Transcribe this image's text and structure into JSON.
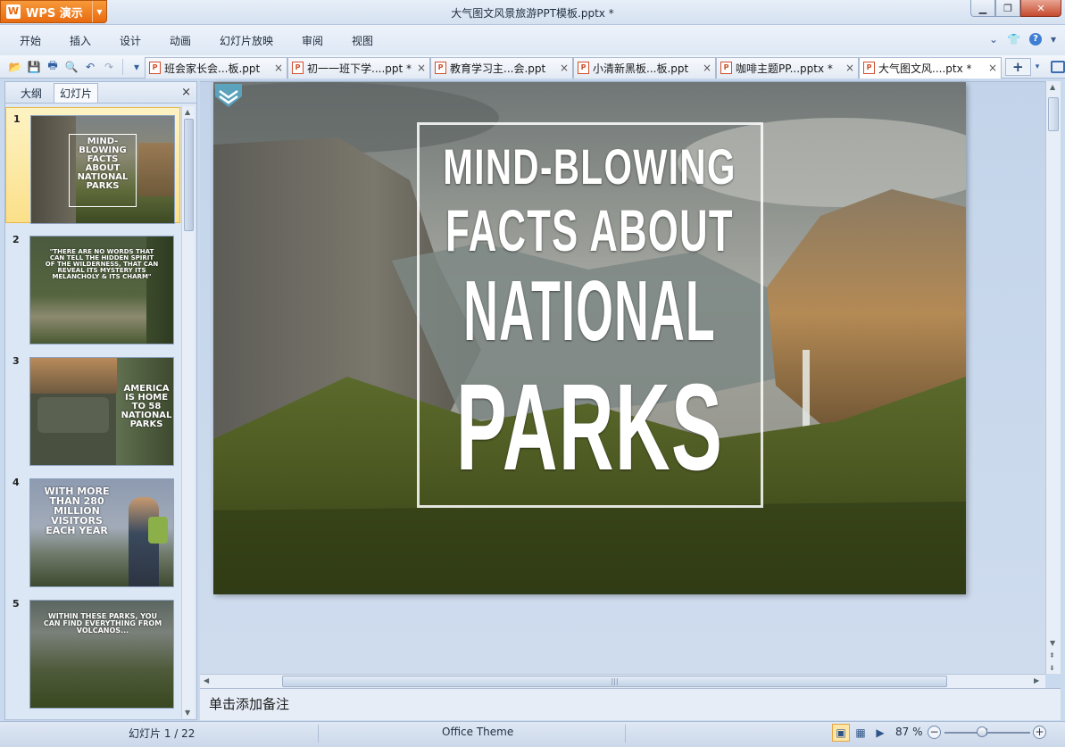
{
  "app": {
    "name": "WPS 演示",
    "logo_letter": "W",
    "window_title": "大气图文风景旅游PPT模板.pptx *",
    "background_tabs": [
      "",
      "",
      "",
      ""
    ]
  },
  "menu": {
    "items": [
      "开始",
      "插入",
      "设计",
      "动画",
      "幻灯片放映",
      "审阅",
      "视图"
    ]
  },
  "toolbar": {
    "icons": [
      "open-icon",
      "save-icon",
      "print-icon",
      "print-preview-icon",
      "undo-icon",
      "redo-icon",
      "customize-icon"
    ]
  },
  "doc_tabs": [
    {
      "name": "班会家长会...板.ppt",
      "close": "×",
      "icon": "P"
    },
    {
      "name": "初一一班下学....ppt *",
      "close": "×",
      "icon": "P"
    },
    {
      "name": "教育学习主...会.ppt",
      "close": "×",
      "icon": "P"
    },
    {
      "name": "小清新黑板...板.ppt",
      "close": "×",
      "icon": "P"
    },
    {
      "name": "咖啡主题PP...pptx *",
      "close": "×",
      "icon": "P"
    },
    {
      "name": "大气图文风....ptx *",
      "close": "×",
      "icon": "P"
    }
  ],
  "new_tab_label": "+",
  "left_panel": {
    "tabs": [
      "大纲",
      "幻灯片"
    ],
    "active_tab": "幻灯片",
    "close": "×",
    "thumbnails": [
      {
        "num": "1",
        "text": "MIND-BLOWING FACTS ABOUT NATIONAL PARKS"
      },
      {
        "num": "2",
        "text": "\"THERE ARE NO WORDS THAT CAN TELL THE HIDDEN SPIRIT OF THE WILDERNESS, THAT CAN REVEAL ITS MYSTERY ITS MELANCHOLY & ITS CHARM\""
      },
      {
        "num": "3",
        "text": "AMERICA IS HOME TO 58 NATIONAL PARKS"
      },
      {
        "num": "4",
        "text": "WITH MORE THAN 280 MILLION VISITORS EACH YEAR"
      },
      {
        "num": "5",
        "text": "WITHIN THESE PARKS, YOU CAN FIND EVERYTHING FROM VOLCANOS..."
      }
    ]
  },
  "slide": {
    "title_lines": [
      "MIND-BLOWING",
      "FACTS ABOUT",
      "NATIONAL",
      "PARKS"
    ]
  },
  "notes_placeholder": "单击添加备注",
  "status": {
    "slide_counter": "幻灯片 1 / 22",
    "theme": "Office Theme",
    "zoom": "87 %",
    "zoom_level": 0.87
  }
}
